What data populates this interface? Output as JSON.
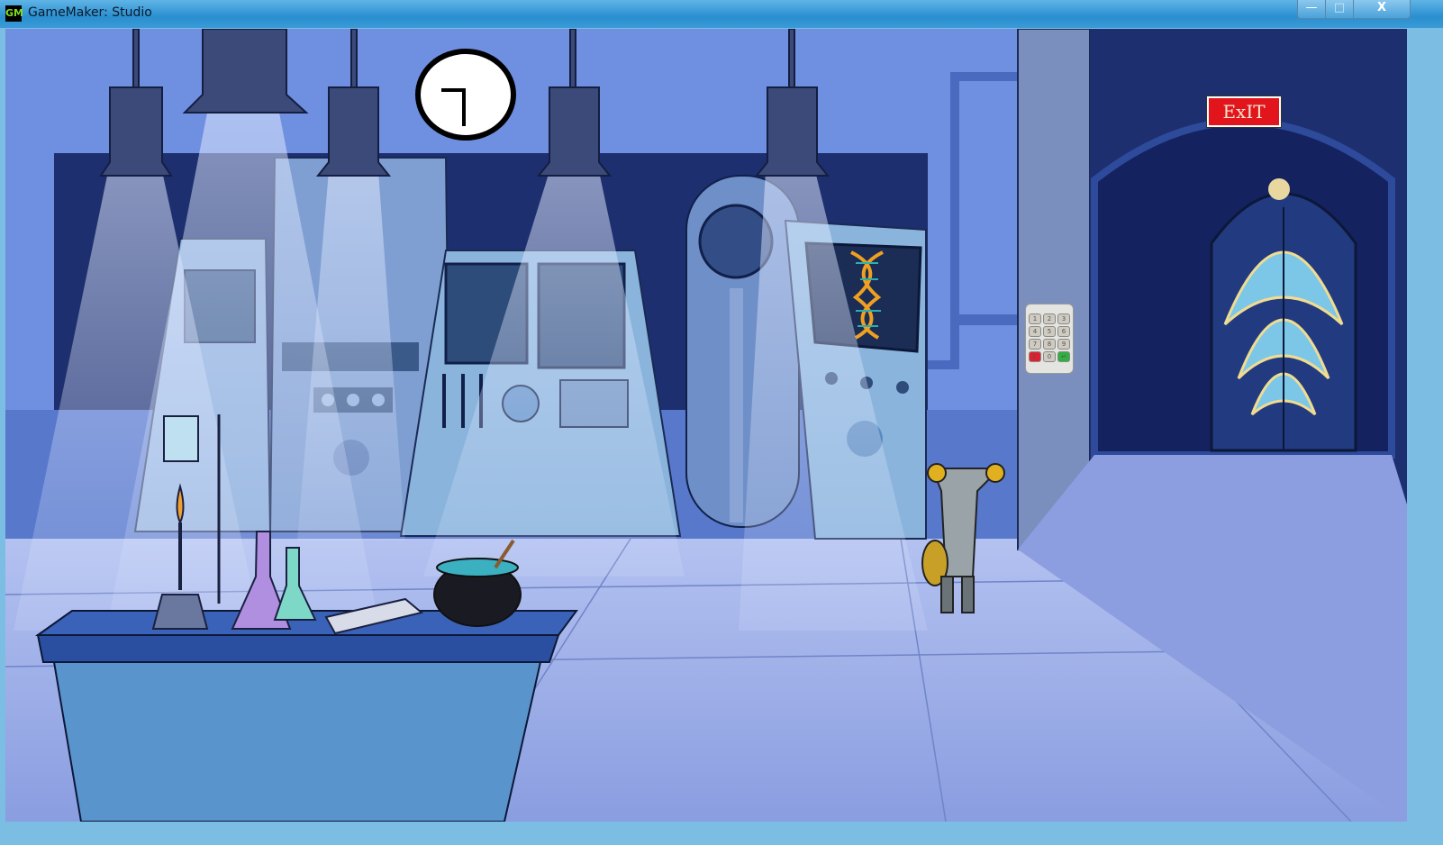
{
  "window": {
    "title": "GameMaker: Studio",
    "app_icon": "gamemaker-icon",
    "minimize": "—",
    "maximize": "□",
    "close": "X"
  },
  "scene": {
    "exit_sign": "ExIT",
    "keypad": {
      "keys": [
        "1",
        "2",
        "3",
        "4",
        "5",
        "6",
        "7",
        "8",
        "9",
        "C",
        "0",
        "↵"
      ]
    },
    "colors": {
      "exit_red": "#e2151d",
      "wall": "#5a78c8",
      "floor": "#a9b8ee"
    }
  }
}
